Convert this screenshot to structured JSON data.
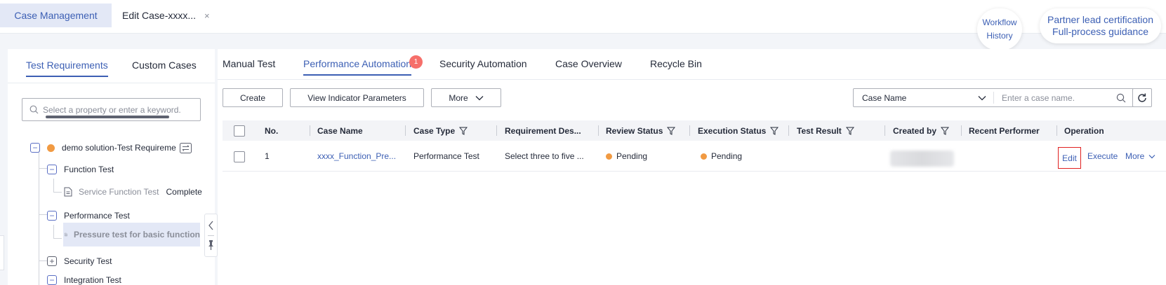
{
  "header": {
    "tabs": [
      {
        "label": "Case Management"
      },
      {
        "label": "Edit Case-xxxx..."
      }
    ],
    "close_symbol": "×",
    "workflow_history": [
      "Workflow",
      "History"
    ],
    "partner_guidance": [
      "Partner lead certification",
      "Full-process guidance"
    ]
  },
  "left_panel": {
    "tabs": [
      {
        "label": "Test Requirements"
      },
      {
        "label": "Custom Cases"
      }
    ],
    "search_placeholder": "Select a property or enter a keyword.",
    "tree": {
      "root": "demo solution-Test Requireme",
      "nodes": [
        {
          "label": "Function Test",
          "toggle": "−"
        },
        {
          "label": "Service Function Test",
          "status": "Complete"
        },
        {
          "label": "Performance Test",
          "toggle": "−"
        },
        {
          "label": "Pressure test for basic function"
        },
        {
          "label": "Security Test",
          "toggle": "+"
        },
        {
          "label": "Integration Test",
          "toggle": "−"
        }
      ]
    }
  },
  "main": {
    "tabs": [
      {
        "label": "Manual Test"
      },
      {
        "label": "Performance Automation"
      },
      {
        "label": "Security Automation"
      },
      {
        "label": "Case Overview"
      },
      {
        "label": "Recycle Bin"
      }
    ],
    "badge_count": "1",
    "toolbar": {
      "create": "Create",
      "view_indicator": "View Indicator Parameters",
      "more": "More",
      "search_field": "Case Name",
      "search_placeholder": "Enter a case name."
    },
    "table": {
      "columns": [
        "No.",
        "Case Name",
        "Case Type",
        "Requirement Des...",
        "Review Status",
        "Execution Status",
        "Test Result",
        "Created by",
        "Recent Performer",
        "Operation"
      ],
      "rows": [
        {
          "no": "1",
          "case_name": "xxxx_Function_Pre...",
          "case_type": "Performance Test",
          "requirement": "Select three to five ...",
          "review_status": "Pending",
          "execution_status": "Pending",
          "ops": {
            "edit": "Edit",
            "execute": "Execute",
            "more": "More"
          }
        }
      ]
    }
  },
  "colors": {
    "accent": "#3c5fb4",
    "pending": "#f19a42",
    "badge": "#f66f6a",
    "highlight_border": "#e02020"
  }
}
